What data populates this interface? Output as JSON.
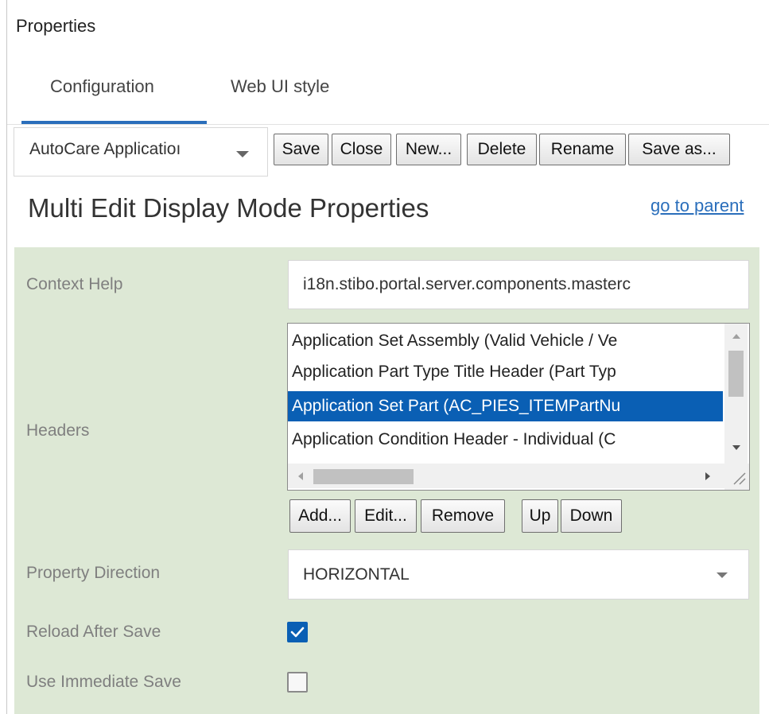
{
  "panel": {
    "title": "Properties"
  },
  "tabs": [
    {
      "label": "Configuration",
      "active": true
    },
    {
      "label": "Web UI style",
      "active": false
    }
  ],
  "toolbar": {
    "config_select_value": "AutoCare Applicatioı",
    "buttons": [
      "Save",
      "Close",
      "New...",
      "Delete",
      "Rename",
      "Save as..."
    ]
  },
  "main": {
    "heading": "Multi Edit Display Mode Properties",
    "parent_link": "go to parent"
  },
  "properties": {
    "context_help": {
      "label": "Context Help",
      "value": "i18n.stibo.portal.server.components.masterc"
    },
    "headers": {
      "label": "Headers",
      "items": [
        "Application Set Assembly (Valid Vehicle / Ve",
        "Application Part Type Title Header (Part Typ",
        "Application Set Part (AC_PIES_ITEMPartNu",
        "Application Condition Header - Individual (C"
      ],
      "selected_index": 2,
      "buttons": [
        "Add...",
        "Edit...",
        "Remove",
        "Up",
        "Down"
      ]
    },
    "property_direction": {
      "label": "Property Direction",
      "value": "HORIZONTAL"
    },
    "reload_after_save": {
      "label": "Reload After Save",
      "checked": true
    },
    "use_immediate_save": {
      "label": "Use Immediate Save",
      "checked": false
    }
  },
  "colors": {
    "accent": "#2a6ebb",
    "selection": "#0a5fb4",
    "panel_background": "#dde8d5"
  }
}
